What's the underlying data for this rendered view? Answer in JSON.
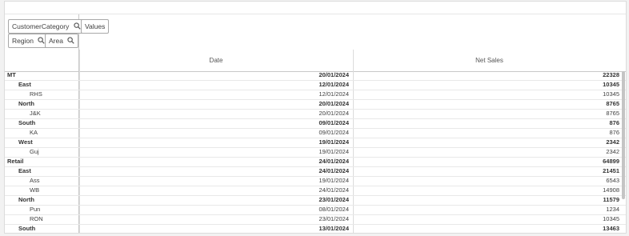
{
  "filters": {
    "customer_category": "CustomerCategory",
    "region": "Region",
    "area": "Area",
    "values": "Values"
  },
  "columns": {
    "date": "Date",
    "net_sales": "Net Sales"
  },
  "rows": [
    {
      "label": "MT",
      "date": "20/01/2024",
      "sales": "22328"
    },
    {
      "label": "East",
      "date": "12/01/2024",
      "sales": "10345"
    },
    {
      "label": "RHS",
      "date": "12/01/2024",
      "sales": "10345"
    },
    {
      "label": "North",
      "date": "20/01/2024",
      "sales": "8765"
    },
    {
      "label": "J&K",
      "date": "20/01/2024",
      "sales": "8765"
    },
    {
      "label": "South",
      "date": "09/01/2024",
      "sales": "876"
    },
    {
      "label": "KA",
      "date": "09/01/2024",
      "sales": "876"
    },
    {
      "label": "West",
      "date": "19/01/2024",
      "sales": "2342"
    },
    {
      "label": "Guj",
      "date": "19/01/2024",
      "sales": "2342"
    },
    {
      "label": "Retail",
      "date": "24/01/2024",
      "sales": "64899"
    },
    {
      "label": "East",
      "date": "24/01/2024",
      "sales": "21451"
    },
    {
      "label": "Ass",
      "date": "19/01/2024",
      "sales": "6543"
    },
    {
      "label": "WB",
      "date": "24/01/2024",
      "sales": "14908"
    },
    {
      "label": "North",
      "date": "23/01/2024",
      "sales": "11579"
    },
    {
      "label": "Pun",
      "date": "08/01/2024",
      "sales": "1234"
    },
    {
      "label": "RON",
      "date": "23/01/2024",
      "sales": "10345"
    },
    {
      "label": "South",
      "date": "13/01/2024",
      "sales": "13463"
    }
  ]
}
